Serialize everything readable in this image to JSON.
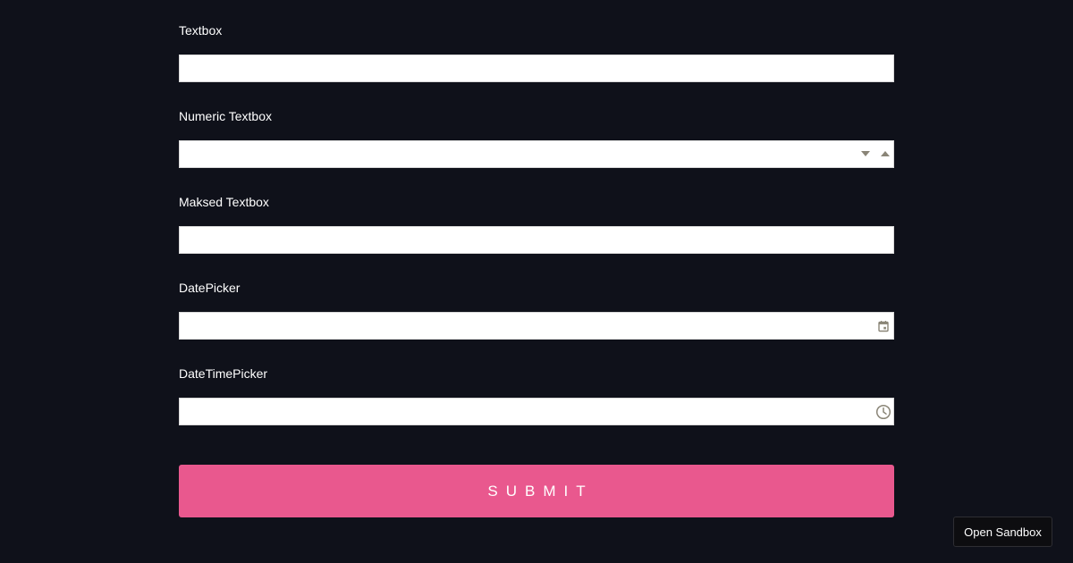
{
  "form": {
    "textbox": {
      "label": "Textbox",
      "value": "",
      "placeholder": ""
    },
    "numeric_textbox": {
      "label": "Numeric Textbox",
      "value": "",
      "placeholder": ""
    },
    "masked_textbox": {
      "label": "Maksed Textbox",
      "value": "",
      "placeholder": ""
    },
    "datepicker": {
      "label": "DatePicker",
      "value": "",
      "placeholder": ""
    },
    "datetimepicker": {
      "label": "DateTimePicker",
      "value": "",
      "placeholder": ""
    },
    "submit_label": "SUBMIT"
  },
  "sandbox_label": "Open Sandbox",
  "icons": {
    "spin_down": "triangle-down-icon",
    "spin_up": "triangle-up-icon",
    "calendar": "calendar-icon",
    "clock": "clock-icon"
  },
  "colors": {
    "background": "#0f111a",
    "accent": "#e9588e",
    "icon": "#8a8577"
  }
}
